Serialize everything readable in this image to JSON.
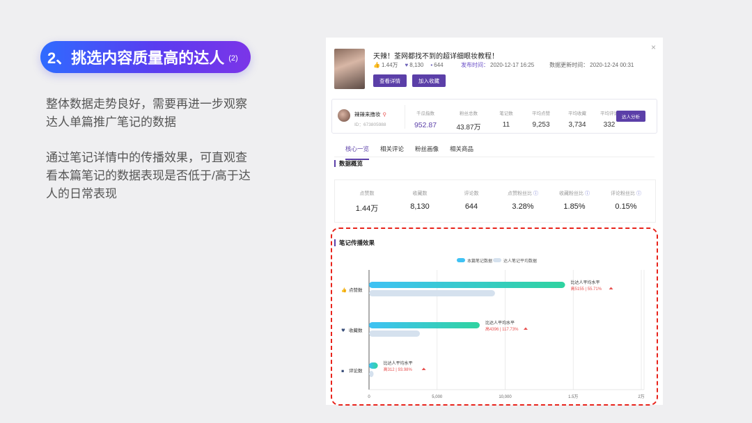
{
  "slide": {
    "title": "2、挑选内容质量高的达人",
    "title_sub": "(2)",
    "paragraph1": "整体数据走势良好，需要再进一步观察达人单篇推广笔记的数据",
    "paragraph2": "通过笔记详情中的传播效果，可直观查看本篇笔记的数据表现是否低于/高于达人的日常表现"
  },
  "note": {
    "close": "×",
    "title": "天辣！荃网都找不到的超详细眼妆教程！",
    "likes": "1.44万",
    "collects": "8,130",
    "comments": "644",
    "publish_label": "发布时间：",
    "publish_time": "2020-12-17 16:25",
    "update_label": "数据更新时间：",
    "update_time": "2020-12-24 00:31",
    "btn_detail": "查看详情",
    "btn_fav": "加入收藏"
  },
  "kol": {
    "name": "辣辣来撸妆",
    "id": "ID：673805988",
    "metrics": [
      {
        "label": "千瓜指数",
        "value": "952.87"
      },
      {
        "label": "粉丝总数",
        "value": "43.87万"
      },
      {
        "label": "笔记数",
        "value": "11"
      },
      {
        "label": "平均点赞",
        "value": "9,253"
      },
      {
        "label": "平均收藏",
        "value": "3,734"
      },
      {
        "label": "平均评论",
        "value": "332"
      }
    ],
    "btn_analyze": "达人分析"
  },
  "tabs": [
    "核心一览",
    "相关评论",
    "粉丝画像",
    "相关商品"
  ],
  "overview": {
    "heading": "数据概览",
    "items": [
      {
        "label": "点赞数",
        "value": "1.44万"
      },
      {
        "label": "收藏数",
        "value": "8,130"
      },
      {
        "label": "评论数",
        "value": "644"
      },
      {
        "label": "点赞粉丝比",
        "value": "3.28%"
      },
      {
        "label": "收藏粉丝比",
        "value": "1.85%"
      },
      {
        "label": "评论粉丝比",
        "value": "0.15%"
      }
    ]
  },
  "chart_data": {
    "type": "bar",
    "title": "笔记传播效果",
    "orientation": "horizontal",
    "categories": [
      "点赞数",
      "收藏数",
      "评论数"
    ],
    "series": [
      {
        "name": "本篇笔记数据",
        "values": [
          14400,
          8130,
          644
        ]
      },
      {
        "name": "达人笔记平均数据",
        "values": [
          9253,
          3734,
          332
        ]
      }
    ],
    "xlim": [
      0,
      20000
    ],
    "x_ticks": [
      "0",
      "5,000",
      "10,000",
      "1.5万",
      "2万"
    ],
    "annotations": [
      {
        "label": "比达人平均水平",
        "detail": "高5155 | 55.71%"
      },
      {
        "label": "比达人平均水平",
        "detail": "高4396 | 117.73%"
      },
      {
        "label": "比达人平均水平",
        "detail": "高312 | 93.98%"
      }
    ],
    "colors": {
      "primary_start": "#3fc2f4",
      "primary_end": "#2fd3a0",
      "secondary": "#d5e1ee",
      "note_red": "#e8504f"
    }
  }
}
